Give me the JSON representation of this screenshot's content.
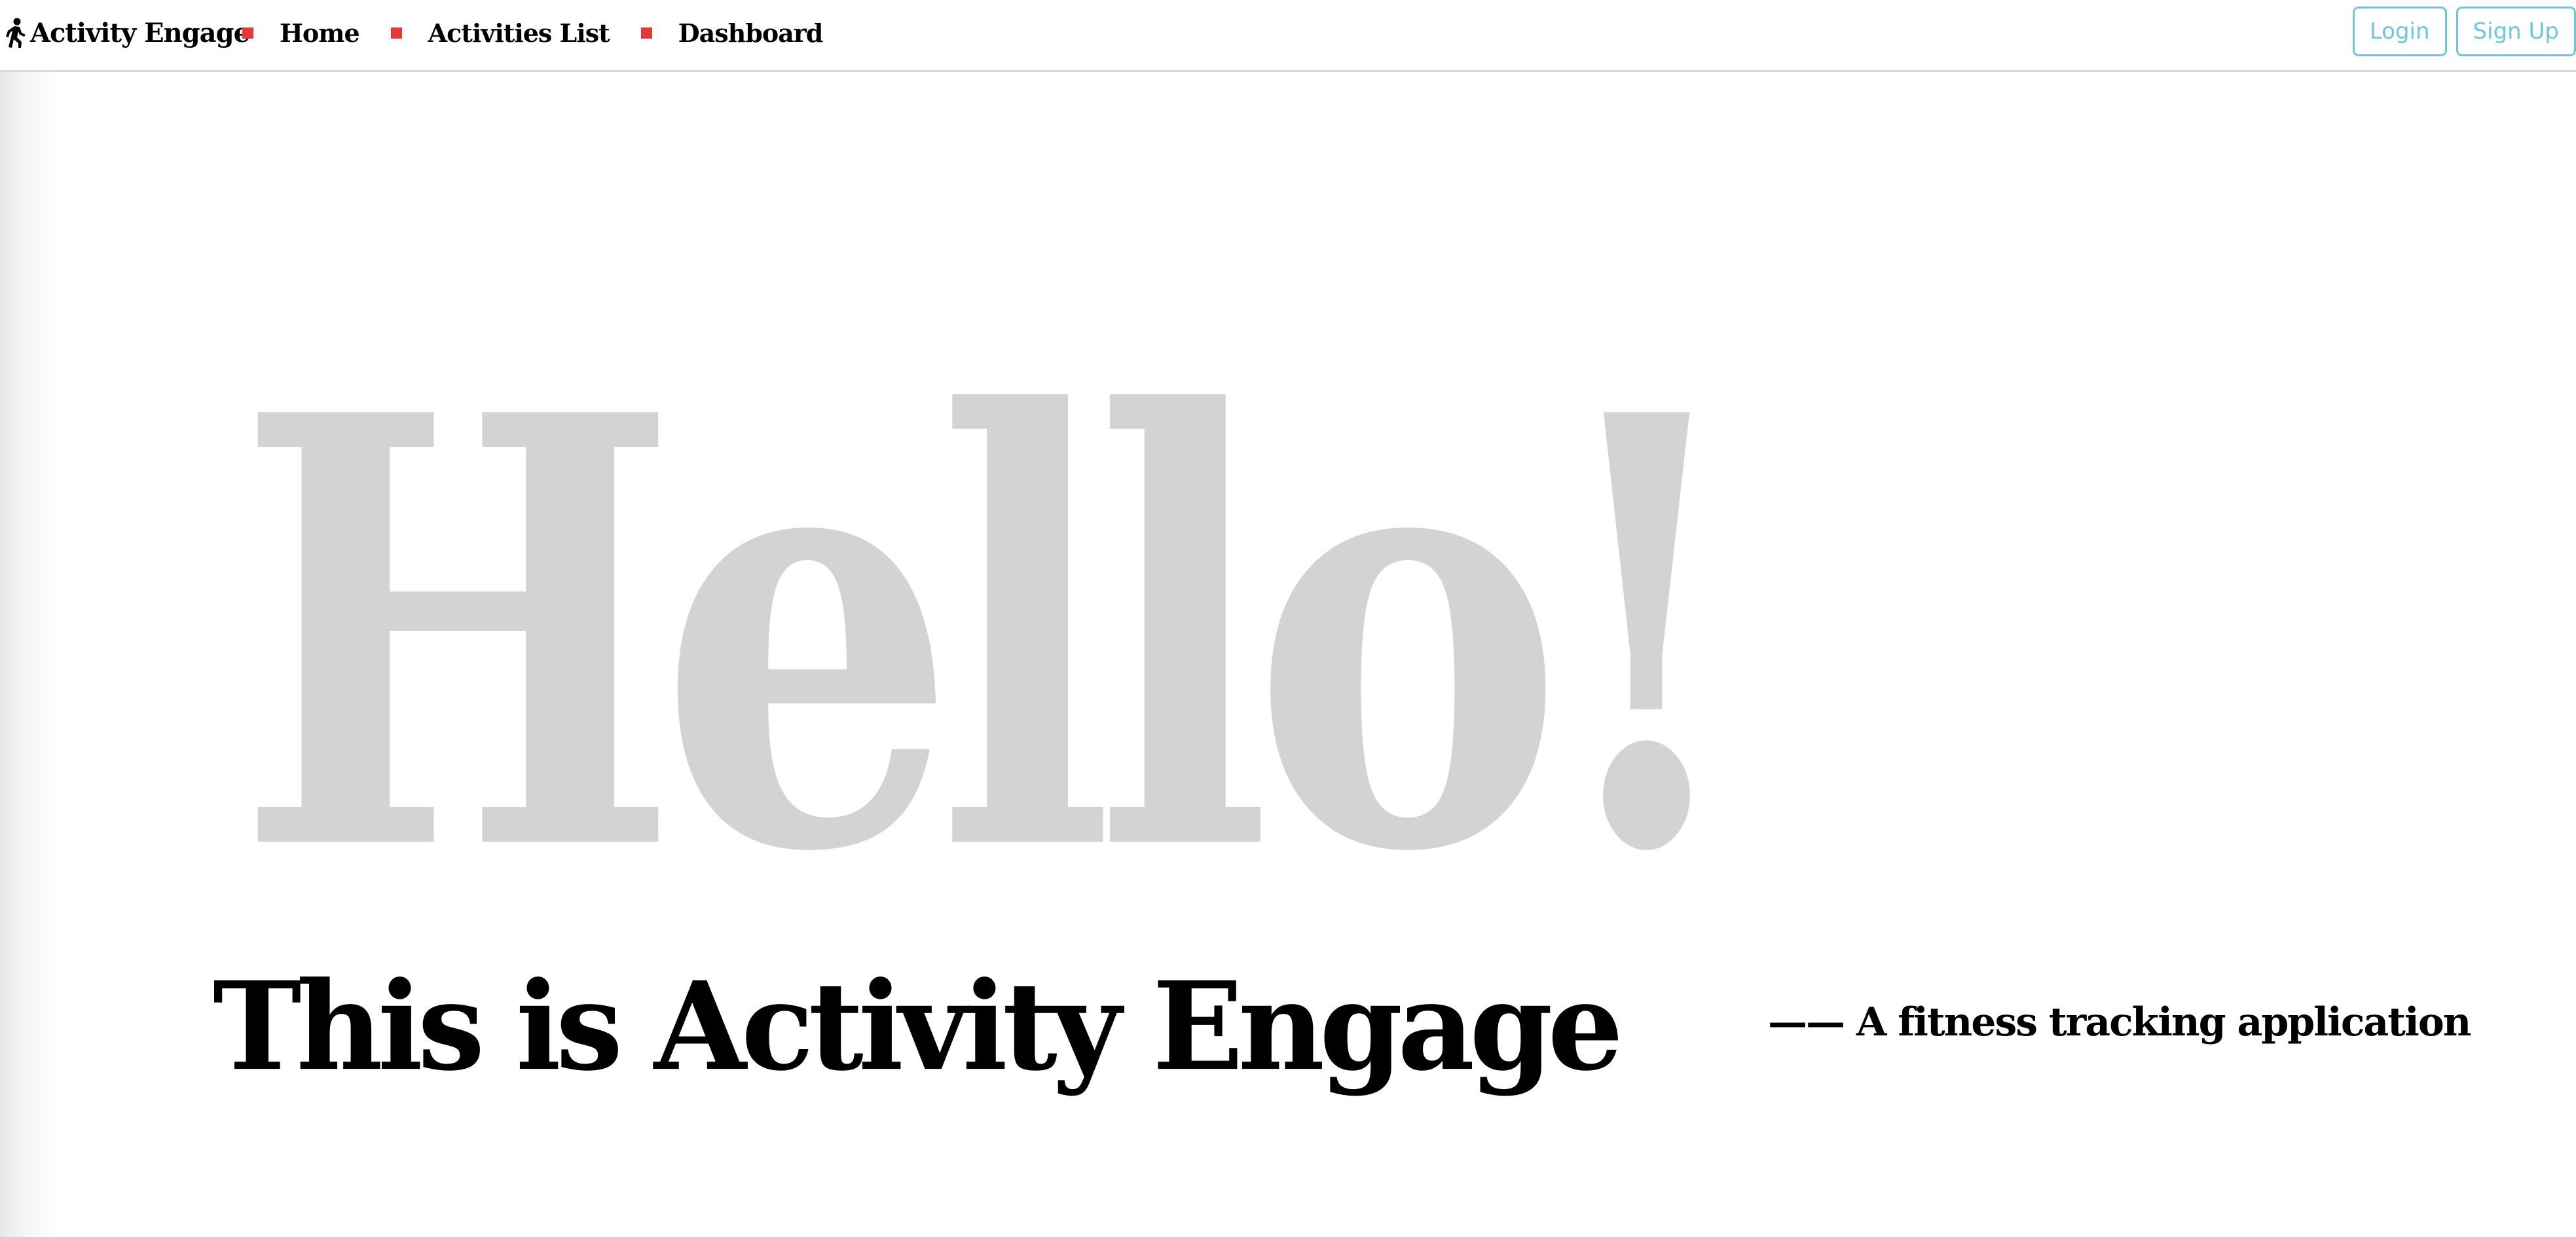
{
  "navbar": {
    "brand": "Activity Engage",
    "links": [
      {
        "label": "Home"
      },
      {
        "label": "Activities List"
      },
      {
        "label": "Dashboard"
      }
    ],
    "login_label": "Login",
    "signup_label": "Sign Up",
    "bullet_color": "#e53935",
    "button_color": "#6bc7dc",
    "brand_icon": "walking-person-icon"
  },
  "hero": {
    "greeting": "Hello!",
    "greeting_color": "#d3d3d3",
    "title": "This is Activity Engage",
    "subtitle": "—— A fitness tracking application"
  }
}
